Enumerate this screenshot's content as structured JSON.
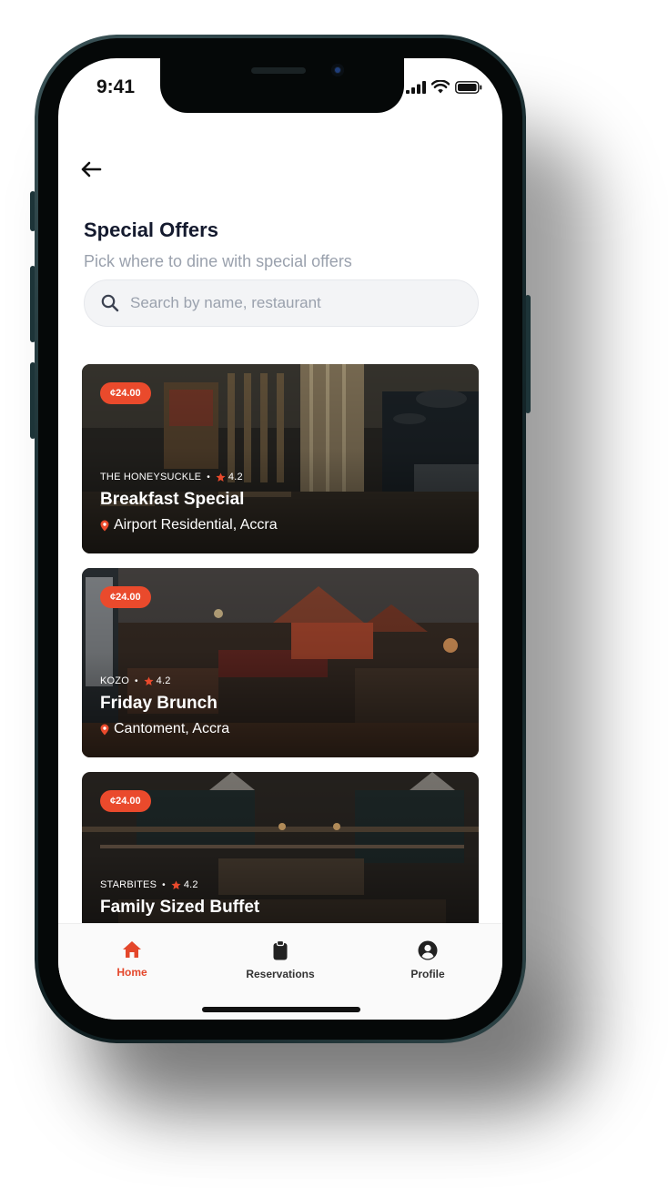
{
  "status_bar": {
    "time": "9:41"
  },
  "header": {
    "title": "Special Offers",
    "subtitle": "Pick where to dine with special offers"
  },
  "search": {
    "placeholder": "Search by name, restaurant"
  },
  "offers": [
    {
      "price": "¢24.00",
      "restaurant": "THE HONEYSUCKLE",
      "rating": "4.2",
      "title": "Breakfast Special",
      "location": "Airport Residential, Accra"
    },
    {
      "price": "¢24.00",
      "restaurant": "KOZO",
      "rating": "4.2",
      "title": "Friday Brunch",
      "location": "Cantoment, Accra"
    },
    {
      "price": "¢24.00",
      "restaurant": "STARBITES",
      "rating": "4.2",
      "title": "Family Sized Buffet",
      "location": ""
    }
  ],
  "tab_bar": {
    "home": "Home",
    "reservations": "Reservations",
    "profile": "Profile"
  },
  "colors": {
    "accent": "#e4472b",
    "badge": "#ea4a2c",
    "title_text": "#141a2e",
    "muted_text": "#9aa1ad"
  }
}
